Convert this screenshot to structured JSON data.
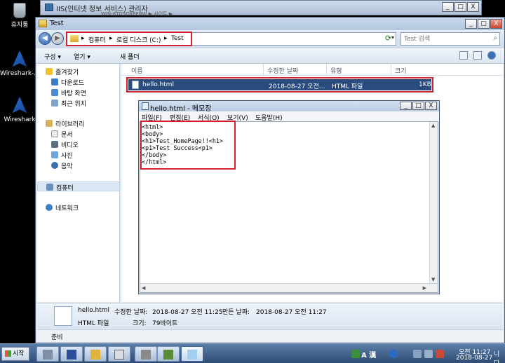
{
  "desktop": {
    "icons": [
      {
        "label": "휴지통"
      },
      {
        "label": "Wireshark-..."
      },
      {
        "label": "Wireshark"
      }
    ]
  },
  "background_window": {
    "title": "IIS(인터넷 정보 서비스) 관리자",
    "subtitle": "WIN-8TD5OX6E8W ▶ 사이트 ▶",
    "controls": {
      "minimize": "_",
      "maximize": "□",
      "close": "X"
    }
  },
  "explorer": {
    "title": "Test",
    "controls": {
      "minimize": "_",
      "maximize": "□",
      "close": "X"
    },
    "address": {
      "crumbs": [
        "▸",
        "컴퓨터",
        "▸",
        "로컬 디스크 (C:)",
        "▸",
        "Test"
      ],
      "search_placeholder": "Test 검색"
    },
    "toolbar": {
      "organize": "구성 ▾",
      "open": "열기 ▾",
      "new_folder": "새 폴더"
    },
    "nav_pane": {
      "favorites": "즐겨찾기",
      "downloads": "다운로드",
      "desktop": "바탕 화면",
      "recent": "최근 위치",
      "libraries": "라이브러리",
      "documents": "문서",
      "videos": "비디오",
      "pictures": "사진",
      "music": "음악",
      "computer": "컴퓨터",
      "network": "네트워크"
    },
    "columns": {
      "name": "이름",
      "modified": "수정한 날짜",
      "type": "유형",
      "size": "크기"
    },
    "files": [
      {
        "name": "hello.html",
        "modified": "2018-08-27 오전...",
        "type": "HTML 파일",
        "size": "1KB"
      }
    ],
    "details": {
      "name": "hello.html",
      "modified_label": "수정한 날짜:",
      "modified": "2018-08-27 오전 11:25",
      "created_label": "만든 날짜:",
      "created": "2018-08-27 오전 11:27",
      "type": "HTML 파일",
      "size_label": "크기:",
      "size": "79바이트"
    },
    "status": "준비"
  },
  "notepad": {
    "title": "hello.html - 메모장",
    "controls": {
      "minimize": "_",
      "maximize": "□",
      "close": "X"
    },
    "menu": [
      "파일(F)",
      "편집(E)",
      "서식(O)",
      "보기(V)",
      "도움말(H)"
    ],
    "lines": [
      "<html>",
      "<body>",
      "<h1>Test_HomePage!!<h1>",
      "<p1>Test Success<p1>",
      "</body>",
      "</html>"
    ]
  },
  "taskbar": {
    "start": "시작",
    "ime": "A 漢",
    "time": "오전 11:27",
    "date": "2018-08-27",
    "partial_text": "니다."
  },
  "colors": {
    "highlight_box": "#d1202f",
    "selection": "#2a4b7e",
    "window_frame": "#dfe7f2"
  }
}
